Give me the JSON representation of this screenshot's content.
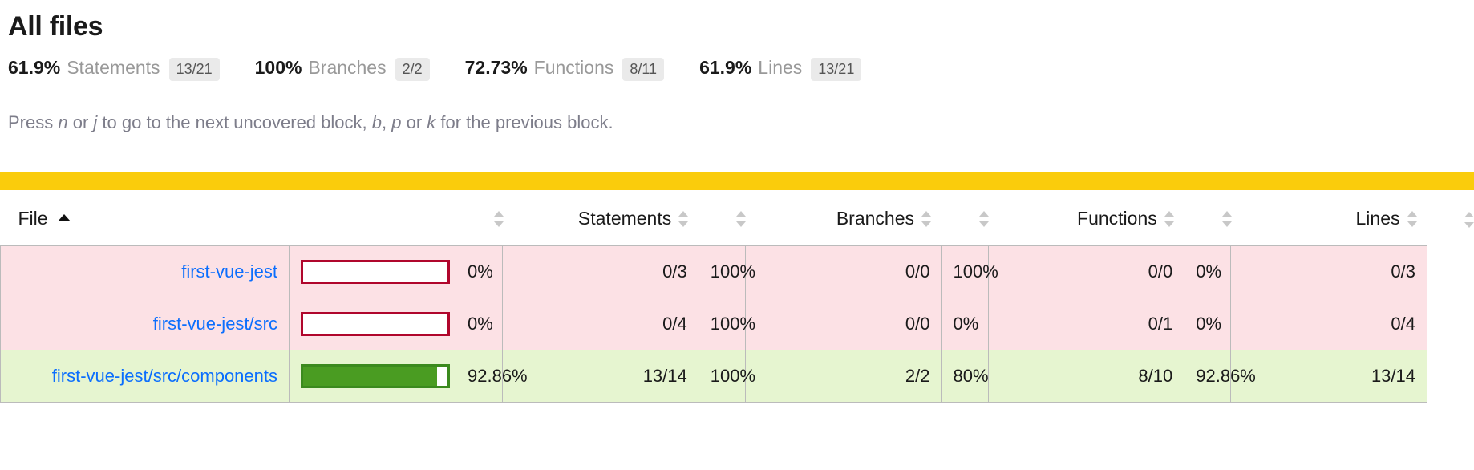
{
  "header": {
    "title": "All files"
  },
  "summary": [
    {
      "pct": "61.9%",
      "label": "Statements",
      "fraction": "13/21"
    },
    {
      "pct": "100%",
      "label": "Branches",
      "fraction": "2/2"
    },
    {
      "pct": "72.73%",
      "label": "Functions",
      "fraction": "8/11"
    },
    {
      "pct": "61.9%",
      "label": "Lines",
      "fraction": "13/21"
    }
  ],
  "help": {
    "part1": "Press ",
    "key_n": "n",
    "part2": " or ",
    "key_j": "j",
    "part3": " to go to the next uncovered block, ",
    "key_b": "b",
    "part4": ", ",
    "key_p": "p",
    "part5": " or ",
    "key_k": "k",
    "part6": " for the previous block."
  },
  "table": {
    "headers": {
      "file": "File",
      "statements": "Statements",
      "branches": "Branches",
      "functions": "Functions",
      "lines": "Lines"
    },
    "rows": [
      {
        "file": "first-vue-jest",
        "bar_pct": 0,
        "bar_state": "low",
        "statements_pct": "0%",
        "statements_abs": "0/3",
        "statements_state": "low",
        "branches_pct": "100%",
        "branches_abs": "0/0",
        "branches_state": "high",
        "functions_pct": "100%",
        "functions_abs": "0/0",
        "functions_state": "high",
        "lines_pct": "0%",
        "lines_abs": "0/3",
        "lines_state": "low",
        "row_state": "low"
      },
      {
        "file": "first-vue-jest/src",
        "bar_pct": 0,
        "bar_state": "low",
        "statements_pct": "0%",
        "statements_abs": "0/4",
        "statements_state": "low",
        "branches_pct": "100%",
        "branches_abs": "0/0",
        "branches_state": "high",
        "functions_pct": "0%",
        "functions_abs": "0/1",
        "functions_state": "low",
        "lines_pct": "0%",
        "lines_abs": "0/4",
        "lines_state": "low",
        "row_state": "low"
      },
      {
        "file": "first-vue-jest/src/components",
        "bar_pct": 92.86,
        "bar_state": "high",
        "statements_pct": "92.86%",
        "statements_abs": "13/14",
        "statements_state": "high",
        "branches_pct": "100%",
        "branches_abs": "2/2",
        "branches_state": "high",
        "functions_pct": "80%",
        "functions_abs": "8/10",
        "functions_state": "high",
        "lines_pct": "92.86%",
        "lines_abs": "13/14",
        "lines_state": "high",
        "row_state": "high"
      }
    ]
  },
  "colors": {
    "divider": "#facc0c",
    "low_bg": "#fce1e5",
    "high_bg": "#e6f5d0",
    "bar_low_border": "#b0062c",
    "bar_high_fill": "#4a9c22",
    "link": "#0b6efd"
  }
}
